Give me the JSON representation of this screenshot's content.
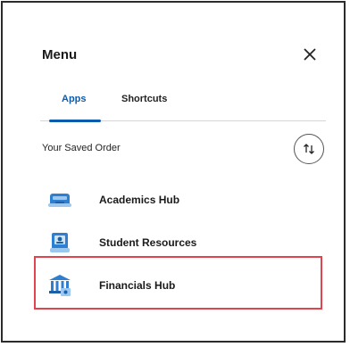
{
  "menu": {
    "title": "Menu",
    "close_icon": "close-icon"
  },
  "tabs": [
    {
      "label": "Apps",
      "active": true
    },
    {
      "label": "Shortcuts",
      "active": false
    }
  ],
  "saved_order": {
    "label": "Your Saved Order",
    "sort_icon": "sort-arrows-icon"
  },
  "apps": [
    {
      "label": "Academics Hub",
      "icon": "graduation-cap-icon"
    },
    {
      "label": "Student Resources",
      "icon": "id-card-icon"
    },
    {
      "label": "Financials Hub",
      "icon": "bank-icon",
      "highlighted": true
    }
  ],
  "colors": {
    "accent": "#0b5cad",
    "highlight": "#e0454f",
    "icon_blue": "#2f7fd0"
  }
}
